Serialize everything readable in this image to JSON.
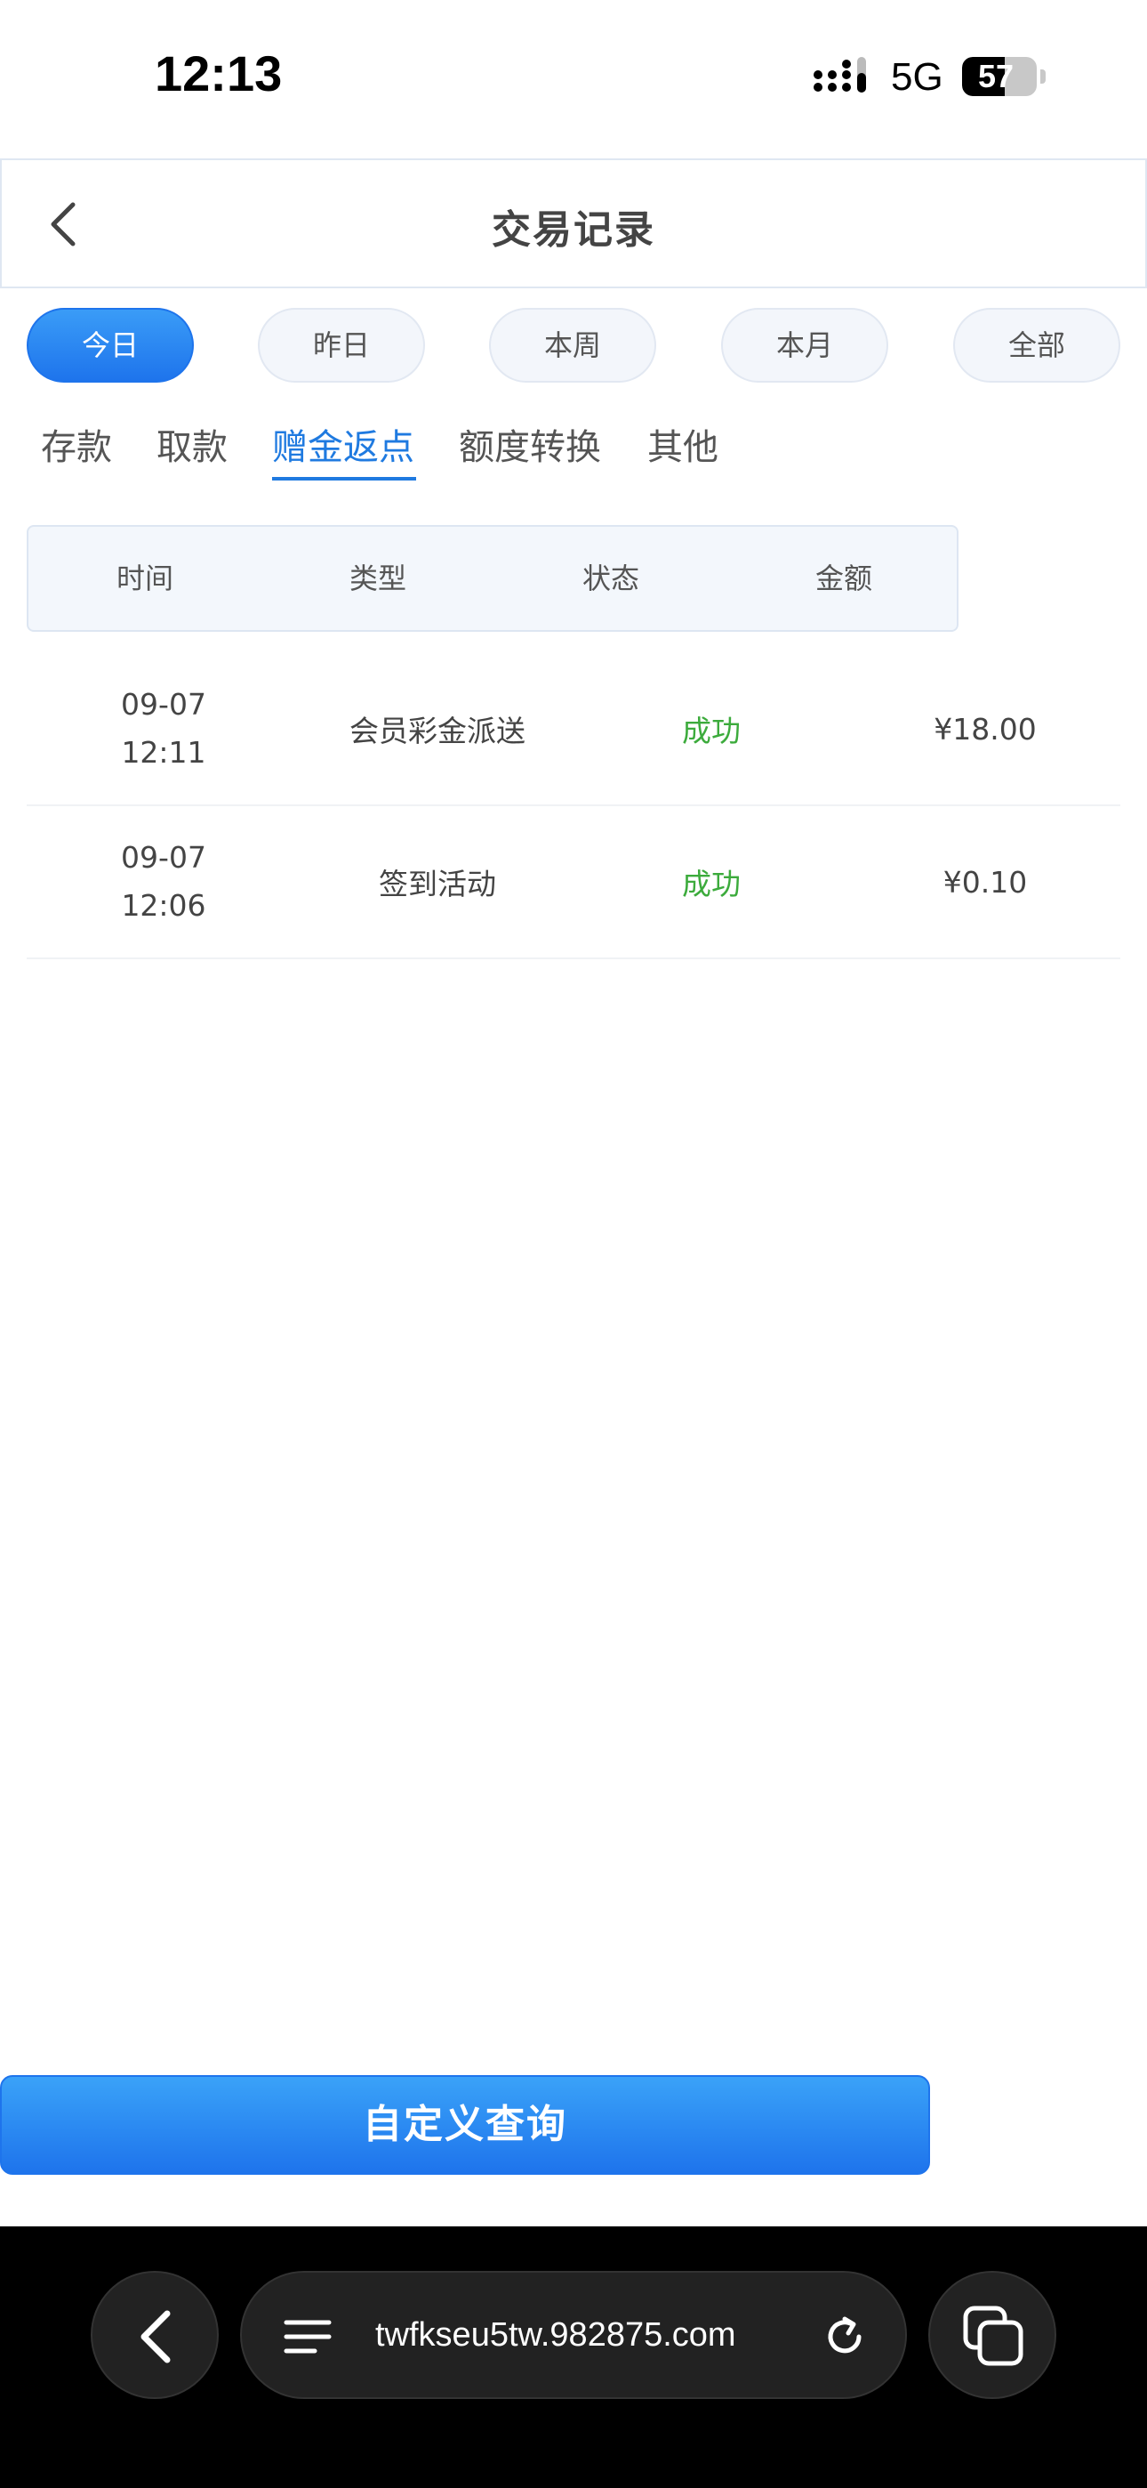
{
  "status_bar": {
    "time": "12:13",
    "network": "5G",
    "battery": "57",
    "battery_level": 0.57
  },
  "header": {
    "title": "交易记录"
  },
  "date_filters": [
    {
      "label": "今日",
      "active": true
    },
    {
      "label": "昨日",
      "active": false
    },
    {
      "label": "本周",
      "active": false
    },
    {
      "label": "本月",
      "active": false
    },
    {
      "label": "全部",
      "active": false
    }
  ],
  "category_tabs": [
    {
      "label": "存款",
      "active": false
    },
    {
      "label": "取款",
      "active": false
    },
    {
      "label": "赠金返点",
      "active": true
    },
    {
      "label": "额度转换",
      "active": false
    },
    {
      "label": "其他",
      "active": false
    }
  ],
  "table": {
    "columns": [
      "时间",
      "类型",
      "状态",
      "金额"
    ],
    "rows": [
      {
        "date": "09-07",
        "time": "12:11",
        "type": "会员彩金派送",
        "status": "成功",
        "amount": "¥18.00"
      },
      {
        "date": "09-07",
        "time": "12:06",
        "type": "签到活动",
        "status": "成功",
        "amount": "¥0.10"
      }
    ]
  },
  "custom_query_label": "自定义查询",
  "browser": {
    "url": "twfkseu5tw.982875.com"
  },
  "colors": {
    "accent": "#1f7ae0",
    "success": "#3cab3c",
    "button": "#1e74ec"
  }
}
